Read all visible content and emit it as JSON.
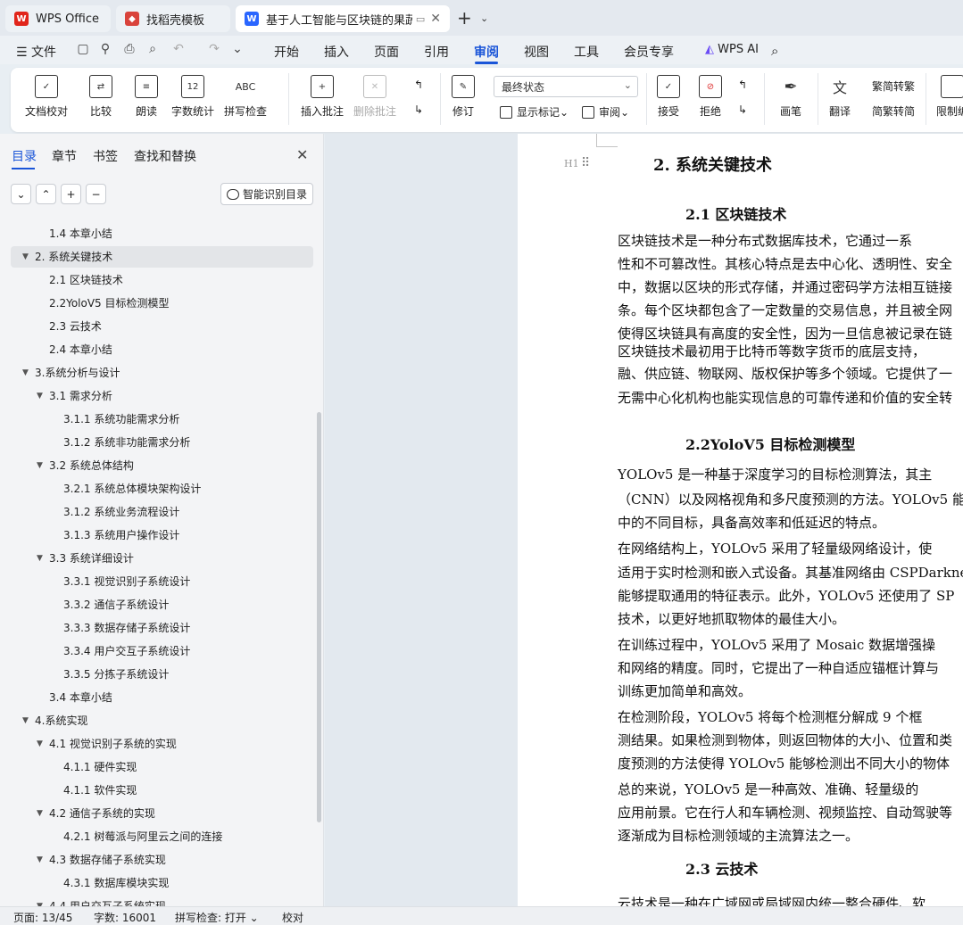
{
  "tabs": [
    {
      "label": "WPS Office",
      "icon": "wps-logo-icon"
    },
    {
      "label": "找稻壳模板",
      "icon": "docer-logo-icon"
    },
    {
      "label": "基于人工智能与区块链的果蔬",
      "icon": "word-doc-icon"
    }
  ],
  "menu": {
    "file": "文件",
    "items": [
      "开始",
      "插入",
      "页面",
      "引用",
      "审阅",
      "视图",
      "工具",
      "会员专享"
    ],
    "active": "审阅",
    "wps_ai": "WPS AI"
  },
  "ribbon": {
    "doc_check": "文档校对",
    "compare": "比较",
    "read_aloud": "朗读",
    "word_count": "字数统计",
    "spell_check": "拼写检查",
    "spell_icon_text": "ABC",
    "count_icon_text": "12",
    "insert_comment": "插入批注",
    "delete_comment": "删除批注",
    "revise": "修订",
    "final_state": "最终状态",
    "show_marks": "显示标记",
    "review": "审阅",
    "accept": "接受",
    "reject": "拒绝",
    "pen": "画笔",
    "translate": "翻译",
    "to_traditional": "简转繁",
    "to_simplified": "繁转简",
    "restrict": "限制编"
  },
  "sidebar": {
    "tabs": [
      "目录",
      "章节",
      "书签",
      "查找和替换"
    ],
    "smart_btn": "智能识别目录",
    "toc": [
      {
        "label": "1.4 本章小结",
        "level": 2,
        "arrow": ""
      },
      {
        "label": "2.  系统关键技术",
        "level": 1,
        "arrow": "▼",
        "selected": true
      },
      {
        "label": "2.1 区块链技术",
        "level": 2,
        "arrow": ""
      },
      {
        "label": "2.2YoloV5 目标检测模型",
        "level": 2,
        "arrow": ""
      },
      {
        "label": "2.3 云技术",
        "level": 2,
        "arrow": ""
      },
      {
        "label": "2.4 本章小结",
        "level": 2,
        "arrow": ""
      },
      {
        "label": "3.系统分析与设计",
        "level": 1,
        "arrow": "▼"
      },
      {
        "label": "3.1 需求分析",
        "level": 2,
        "arrow": "▼"
      },
      {
        "label": "3.1.1 系统功能需求分析",
        "level": 3,
        "arrow": ""
      },
      {
        "label": "3.1.2 系统非功能需求分析",
        "level": 3,
        "arrow": ""
      },
      {
        "label": "3.2 系统总体结构",
        "level": 2,
        "arrow": "▼"
      },
      {
        "label": "3.2.1 系统总体模块架构设计",
        "level": 3,
        "arrow": ""
      },
      {
        "label": "3.1.2 系统业务流程设计",
        "level": 3,
        "arrow": ""
      },
      {
        "label": "3.1.3 系统用户操作设计",
        "level": 3,
        "arrow": ""
      },
      {
        "label": "3.3 系统详细设计",
        "level": 2,
        "arrow": "▼"
      },
      {
        "label": "3.3.1 视觉识别子系统设计",
        "level": 3,
        "arrow": ""
      },
      {
        "label": "3.3.2 通信子系统设计",
        "level": 3,
        "arrow": ""
      },
      {
        "label": "3.3.3 数据存储子系统设计",
        "level": 3,
        "arrow": ""
      },
      {
        "label": "3.3.4 用户交互子系统设计",
        "level": 3,
        "arrow": ""
      },
      {
        "label": "3.3.5 分拣子系统设计",
        "level": 3,
        "arrow": ""
      },
      {
        "label": "3.4 本章小结",
        "level": 2,
        "arrow": ""
      },
      {
        "label": "4.系统实现",
        "level": 1,
        "arrow": "▼"
      },
      {
        "label": "4.1 视觉识别子系统的实现",
        "level": 2,
        "arrow": "▼"
      },
      {
        "label": "4.1.1 硬件实现",
        "level": 3,
        "arrow": ""
      },
      {
        "label": "4.1.1 软件实现",
        "level": 3,
        "arrow": ""
      },
      {
        "label": "4.2 通信子系统的实现",
        "level": 2,
        "arrow": "▼"
      },
      {
        "label": "4.2.1 树莓派与阿里云之间的连接",
        "level": 3,
        "arrow": ""
      },
      {
        "label": "4.3 数据存储子系统实现",
        "level": 2,
        "arrow": "▼"
      },
      {
        "label": "4.3.1 数据库模块实现",
        "level": 3,
        "arrow": ""
      },
      {
        "label": "4.4 用户交互子系统实现",
        "level": 2,
        "arrow": "▼"
      }
    ]
  },
  "document": {
    "h1": "2.  系统关键技术",
    "h1_hint": "H1",
    "lines": [
      {
        "kind": "h2",
        "text": "2.1 区块链技术"
      },
      {
        "kind": "p",
        "text": "    区块链技术是一种分布式数据库技术，它通过一系"
      },
      {
        "kind": "p",
        "text": "性和不可篡改性。其核心特点是去中心化、透明性、安全"
      },
      {
        "kind": "p",
        "text": "中，数据以区块的形式存储，并通过密码学方法相互链接"
      },
      {
        "kind": "p",
        "text": "条。每个区块都包含了一定数量的交易信息，并且被全网"
      },
      {
        "kind": "p",
        "text": "使得区块链具有高度的安全性，因为一旦信息被记录在链"
      },
      {
        "kind": "p",
        "text": "    区块链技术最初用于比特币等数字货币的底层支持，"
      },
      {
        "kind": "p",
        "text": "融、供应链、物联网、版权保护等多个领域。它提供了一"
      },
      {
        "kind": "p",
        "text": "无需中心化机构也能实现信息的可靠传递和价值的安全转"
      },
      {
        "kind": "h2",
        "text": "2.2YoloV5 目标检测模型"
      },
      {
        "kind": "p",
        "text": "    YOLOv5 是一种基于深度学习的目标检测算法，其主"
      },
      {
        "kind": "p",
        "text": "（CNN）以及网格视角和多尺度预测的方法。YOLOv5 能"
      },
      {
        "kind": "p",
        "text": "中的不同目标，具备高效率和低延迟的特点。"
      },
      {
        "kind": "p",
        "text": "    在网络结构上，YOLOv5 采用了轻量级网络设计，使"
      },
      {
        "kind": "p",
        "text": "适用于实时检测和嵌入式设备。其基准网络由 CSPDarknet"
      },
      {
        "kind": "p",
        "text": "能够提取通用的特征表示。此外，YOLOv5 还使用了 SP"
      },
      {
        "kind": "p",
        "text": "技术，以更好地抓取物体的最佳大小。"
      },
      {
        "kind": "p",
        "text": "    在训练过程中，YOLOv5 采用了 Mosaic 数据增强操"
      },
      {
        "kind": "p",
        "text": "和网络的精度。同时，它提出了一种自适应锚框计算与"
      },
      {
        "kind": "p",
        "text": "训练更加简单和高效。"
      },
      {
        "kind": "p",
        "text": "    在检测阶段，YOLOv5 将每个检测框分解成 9 个框"
      },
      {
        "kind": "p",
        "text": "测结果。如果检测到物体，则返回物体的大小、位置和类"
      },
      {
        "kind": "p",
        "text": "度预测的方法使得 YOLOv5 能够检测出不同大小的物体"
      },
      {
        "kind": "p",
        "text": "    总的来说，YOLOv5 是一种高效、准确、轻量级的"
      },
      {
        "kind": "p",
        "text": "应用前景。它在行人和车辆检测、视频监控、自动驾驶等"
      },
      {
        "kind": "p",
        "text": "逐渐成为目标检测领域的主流算法之一。"
      },
      {
        "kind": "h2",
        "text": "2.3 云技术"
      },
      {
        "kind": "p",
        "text": "    云技术是一种在广域网或局域网内统一整合硬件、软"
      }
    ]
  },
  "status": {
    "page": "页面: 13/45",
    "words": "字数: 16001",
    "spell": "拼写检查: 打开",
    "proof": "校对"
  }
}
